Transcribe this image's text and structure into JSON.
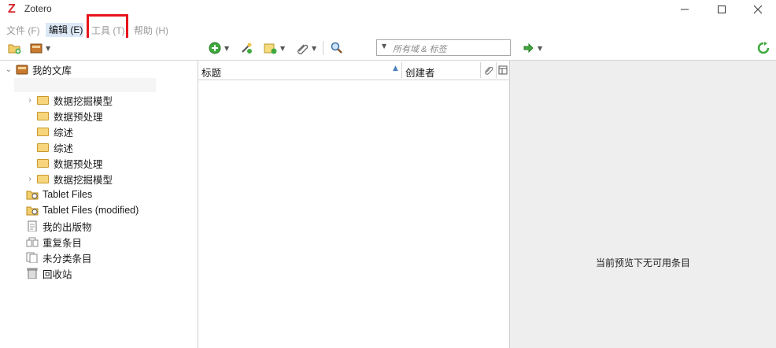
{
  "window": {
    "title": "Zotero",
    "logo_letter": "Z"
  },
  "menubar": [
    {
      "label": "文件 (F)",
      "id": "file"
    },
    {
      "label": "编辑 (E)",
      "id": "edit"
    },
    {
      "label": "工具 (T)",
      "id": "tools"
    },
    {
      "label": "帮助 (H)",
      "id": "help"
    }
  ],
  "search": {
    "placeholder": "所有域 & 标签"
  },
  "library": {
    "root": "我的文库",
    "folders": [
      {
        "label": "数据挖掘模型",
        "expandable": true
      },
      {
        "label": "数据预处理",
        "expandable": false
      },
      {
        "label": "综述",
        "expandable": false
      },
      {
        "label": "综述",
        "expandable": false
      },
      {
        "label": "数据预处理",
        "expandable": false
      },
      {
        "label": "数据挖掘模型",
        "expandable": true
      }
    ],
    "special": [
      {
        "label": "Tablet Files",
        "icon": "saved-search-icon"
      },
      {
        "label": "Tablet Files (modified)",
        "icon": "saved-search-icon"
      },
      {
        "label": "我的出版物",
        "icon": "document-icon"
      },
      {
        "label": "重复条目",
        "icon": "duplicate-icon"
      },
      {
        "label": "未分类条目",
        "icon": "unfiled-icon"
      },
      {
        "label": "回收站",
        "icon": "trash-icon"
      }
    ]
  },
  "items_table": {
    "col_title": "标题",
    "col_creator": "创建者"
  },
  "item_pane": {
    "empty_message": "当前预览下无可用条目"
  },
  "colors": {
    "highlight_box": "#e8141c",
    "menu_active": "#dce8f6",
    "logo": "#d8232a"
  }
}
